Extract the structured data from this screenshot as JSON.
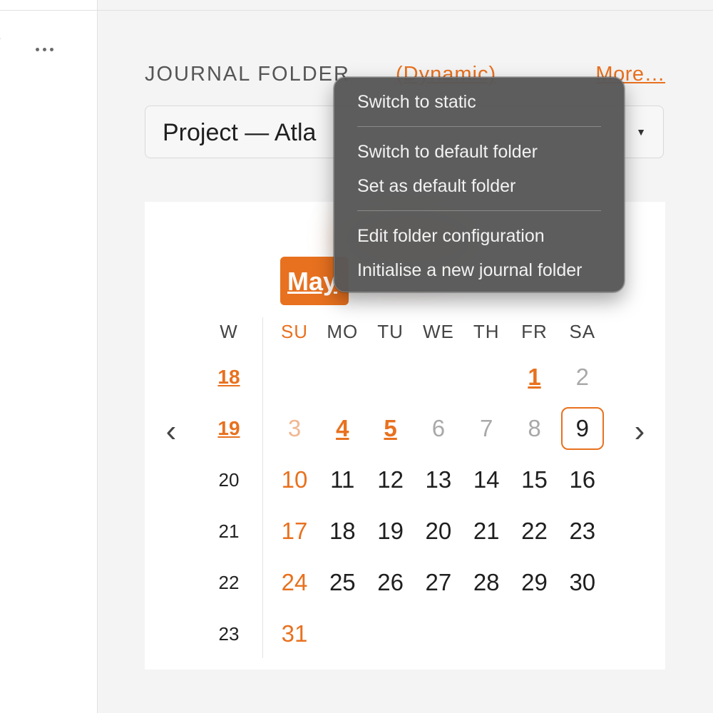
{
  "left_pane": {
    "more_label": "More options"
  },
  "folder": {
    "label": "JOURNAL FOLDER",
    "mode": "(Dynamic)",
    "more": "More…",
    "selected": "Project — Atla"
  },
  "calendar": {
    "month": "May",
    "week_header": "W",
    "weekday_headers": [
      "SU",
      "MO",
      "TU",
      "WE",
      "TH",
      "FR",
      "SA"
    ],
    "prev_label": "‹",
    "next_label": "›",
    "weeks": [
      {
        "week": "18",
        "week_link": true,
        "days": [
          null,
          null,
          null,
          null,
          null,
          "1",
          "2"
        ]
      },
      {
        "week": "19",
        "week_link": true,
        "days": [
          "3",
          "4",
          "5",
          "6",
          "7",
          "8",
          "9"
        ]
      },
      {
        "week": "20",
        "week_link": false,
        "days": [
          "10",
          "11",
          "12",
          "13",
          "14",
          "15",
          "16"
        ]
      },
      {
        "week": "21",
        "week_link": false,
        "days": [
          "17",
          "18",
          "19",
          "20",
          "21",
          "22",
          "23"
        ]
      },
      {
        "week": "22",
        "week_link": false,
        "days": [
          "24",
          "25",
          "26",
          "27",
          "28",
          "29",
          "30"
        ]
      },
      {
        "week": "23",
        "week_link": false,
        "days": [
          "31",
          null,
          null,
          null,
          null,
          null,
          null
        ]
      }
    ],
    "days_with_entries": [
      "1",
      "4",
      "5"
    ],
    "past_days": [
      "2",
      "3",
      "6",
      "7",
      "8"
    ],
    "today": "9",
    "accent_color": "#e8711f"
  },
  "menu": {
    "items": [
      "Switch to static",
      "Switch to default folder",
      "Set as default folder",
      "Edit folder configuration",
      "Initialise a new journal folder"
    ]
  }
}
